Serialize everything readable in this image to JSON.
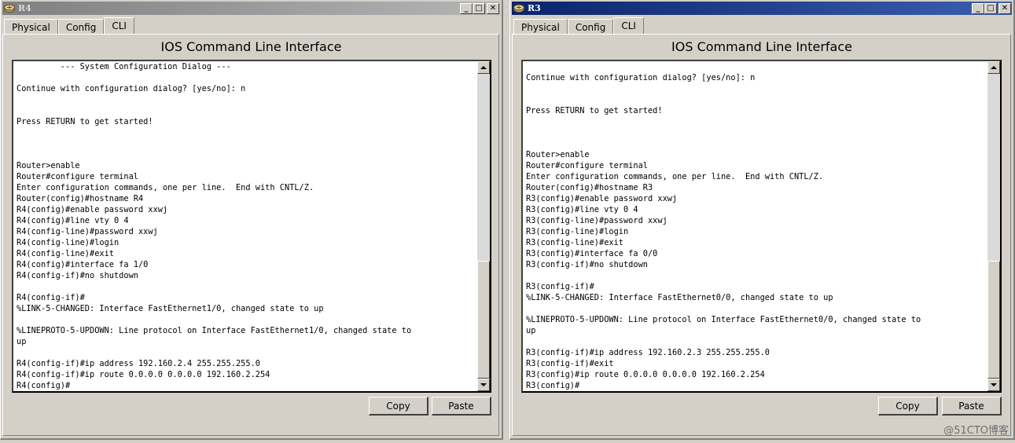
{
  "windows": {
    "r4": {
      "title": "R4",
      "tabs": [
        "Physical",
        "Config",
        "CLI"
      ],
      "selected_tab": "CLI",
      "cli_title": "IOS Command Line Interface",
      "terminal_lines": [
        "         --- System Configuration Dialog ---",
        "",
        "Continue with configuration dialog? [yes/no]: n",
        "",
        "",
        "Press RETURN to get started!",
        "",
        "",
        "",
        "Router>enable",
        "Router#configure terminal",
        "Enter configuration commands, one per line.  End with CNTL/Z.",
        "Router(config)#hostname R4",
        "R4(config)#enable password xxwj",
        "R4(config)#line vty 0 4",
        "R4(config-line)#password xxwj",
        "R4(config-line)#login",
        "R4(config-line)#exit",
        "R4(config)#interface fa 1/0",
        "R4(config-if)#no shutdown",
        "",
        "R4(config-if)#",
        "%LINK-5-CHANGED: Interface FastEthernet1/0, changed state to up",
        "",
        "%LINEPROTO-5-UPDOWN: Line protocol on Interface FastEthernet1/0, changed state to",
        "up",
        "",
        "R4(config-if)#ip address 192.160.2.4 255.255.255.0",
        "R4(config-if)#ip route 0.0.0.0 0.0.0.0 192.160.2.254",
        "R4(config)#"
      ],
      "copy_label": "Copy",
      "paste_label": "Paste"
    },
    "r3": {
      "title": "R3",
      "tabs": [
        "Physical",
        "Config",
        "CLI"
      ],
      "selected_tab": "CLI",
      "cli_title": "IOS Command Line Interface",
      "terminal_lines": [
        "",
        "Continue with configuration dialog? [yes/no]: n",
        "",
        "",
        "Press RETURN to get started!",
        "",
        "",
        "",
        "Router>enable",
        "Router#configure terminal",
        "Enter configuration commands, one per line.  End with CNTL/Z.",
        "Router(config)#hostname R3",
        "R3(config)#enable password xxwj",
        "R3(config)#line vty 0 4",
        "R3(config-line)#password xxwj",
        "R3(config-line)#login",
        "R3(config-line)#exit",
        "R3(config)#interface fa 0/0",
        "R3(config-if)#no shutdown",
        "",
        "R3(config-if)#",
        "%LINK-5-CHANGED: Interface FastEthernet0/0, changed state to up",
        "",
        "%LINEPROTO-5-UPDOWN: Line protocol on Interface FastEthernet0/0, changed state to",
        "up",
        "",
        "R3(config-if)#ip address 192.160.2.3 255.255.255.0",
        "R3(config-if)#exit",
        "R3(config)#ip route 0.0.0.0 0.0.0.0 192.160.2.254",
        "R3(config)#"
      ],
      "copy_label": "Copy",
      "paste_label": "Paste"
    }
  },
  "window_controls": {
    "minimize": "_",
    "maximize": "□",
    "close": "✕"
  },
  "watermark": "@51CTO博客",
  "colors": {
    "active_titlebar": "#0a246a",
    "inactive_titlebar": "#808080",
    "window_face": "#d4d0c8",
    "terminal_bg": "#ffffff"
  }
}
